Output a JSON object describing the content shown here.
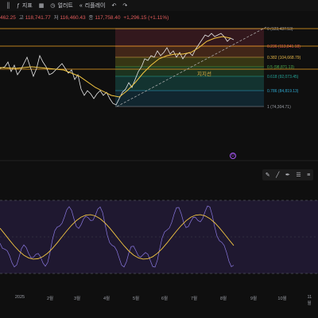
{
  "toolbar": {
    "items": [
      {
        "icon": "candles-icon",
        "glyph": "║",
        "label": ""
      },
      {
        "icon": "fx-icon",
        "glyph": "ƒ",
        "label": "지표"
      },
      {
        "icon": "grid-icon",
        "glyph": "▦",
        "label": "☰"
      },
      {
        "icon": "alarm-icon",
        "glyph": "◷",
        "label": "얼러트"
      },
      {
        "icon": "replay-icon",
        "glyph": "«",
        "label": "리플레이"
      },
      {
        "icon": "undo-icon",
        "glyph": "↶",
        "label": ""
      },
      {
        "icon": "redo-icon",
        "glyph": "↷",
        "label": ""
      }
    ]
  },
  "ohlc": {
    "open_value": "462.25",
    "high_label": "고",
    "high_value": "118,741.77",
    "low_label": "저",
    "low_value": "116,460.43",
    "close_label": "종",
    "close_value": "117,758.40",
    "change": "+1,296.15 (+1.11%)"
  },
  "fib_levels": [
    {
      "label": "0 (123,437.53)",
      "color": "#9a9da5",
      "fill": "#3a1a20"
    },
    {
      "label": "0.236 (113,841.18)",
      "color": "#e5534b",
      "fill": "#4a2a1a"
    },
    {
      "label": "0.382 (104,668.79)",
      "color": "#e9b949",
      "fill": "#3d3d15"
    },
    {
      "label": "0.5 (98,871.13)",
      "color": "#4caf50",
      "fill": "#1e3a22"
    },
    {
      "label": "0.618 (92,073.45)",
      "color": "#26a69a",
      "fill": "#143a36"
    },
    {
      "label": "0.786 (84,819.13)",
      "color": "#2ea7cf",
      "fill": "#122a35"
    },
    {
      "label": "1 (74,304.71)",
      "color": "#9a9da5",
      "fill": "none"
    }
  ],
  "annotation": "지지선",
  "months": [
    "2025",
    "2월",
    "3월",
    "4월",
    "5월",
    "6월",
    "7월",
    "8월",
    "9월",
    "10월",
    "11월"
  ],
  "colors": {
    "background": "#0f0f0f",
    "price_line": "#e9e9e9",
    "ma_line": "#f5c842",
    "horizontal_levels": "#f5a623",
    "osc_fill": "#1f1830",
    "osc_line": "#8a78e0",
    "osc_signal": "#f5c842"
  },
  "mini_toolbar": [
    "pencil-icon",
    "line-icon",
    "pen-icon",
    "list-icon",
    "menu-icon"
  ],
  "alert_glyph": "⏻"
}
